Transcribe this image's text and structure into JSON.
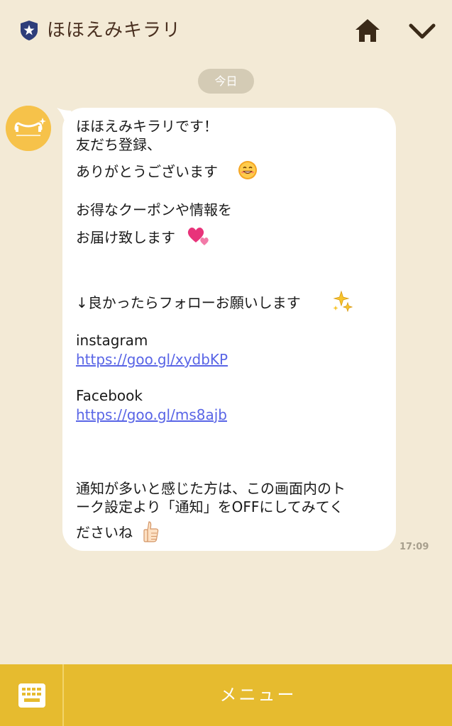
{
  "header": {
    "title": "ほほえみキラリ",
    "icons": {
      "badge": "shield-star-icon",
      "home": "home-icon",
      "collapse": "chevron-down-icon"
    }
  },
  "chat": {
    "date_label": "今日",
    "message": {
      "lines": {
        "l1": "ほほえみキラリです！",
        "l2": "友だち登録、",
        "l3": "ありがとうございます",
        "l4": "お得なクーポンや情報を",
        "l5": "お届け致します",
        "l6": "↓良かったらフォローお願いします",
        "l7": "instagram",
        "l9": "Facebook",
        "l11": "通知が多いと感じた方は、この画面内のト",
        "l12": "ーク設定より「通知」をOFFにしてみてく",
        "l13": "ださいね"
      },
      "links": {
        "instagram": "https://goo.gl/xydbKP",
        "facebook": "https://goo.gl/ms8ajb"
      },
      "time": "17:09"
    }
  },
  "footer": {
    "keyboard_icon": "keyboard-icon",
    "menu_label": "メニュー"
  },
  "colors": {
    "background": "#f3ead6",
    "bar": "#e6bb2f",
    "link": "#5965e6",
    "title": "#4a3020"
  }
}
